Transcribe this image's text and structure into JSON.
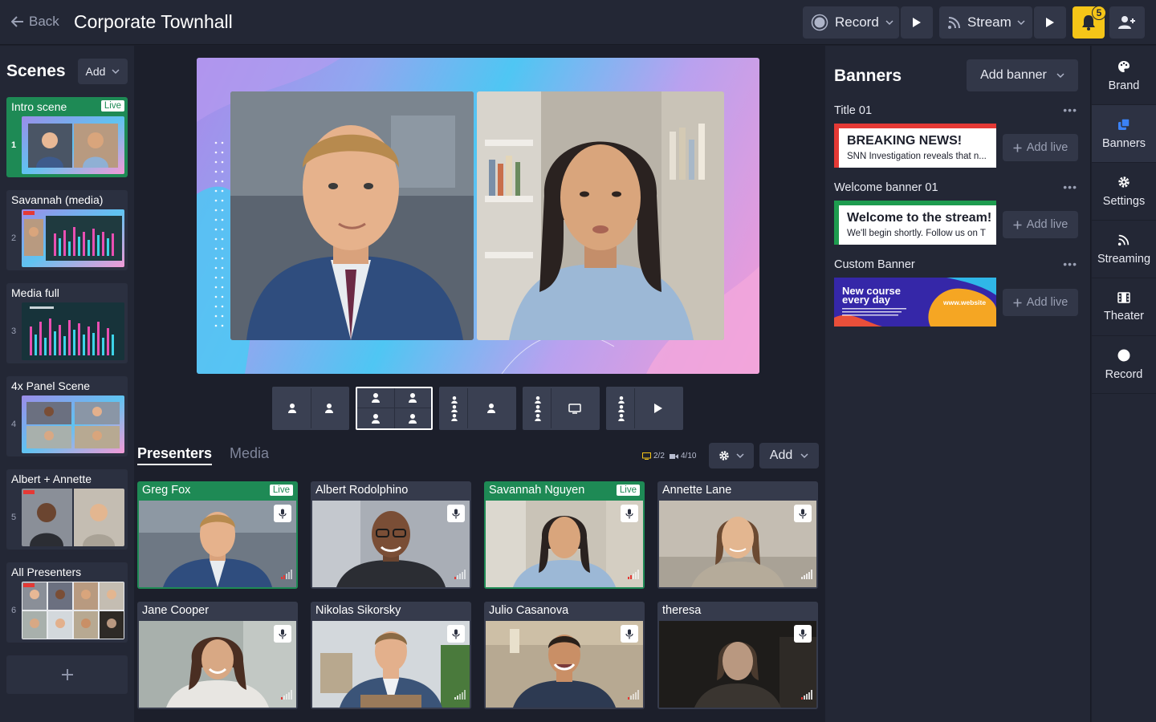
{
  "header": {
    "back_label": "Back",
    "title": "Corporate Townhall",
    "record_label": "Record",
    "stream_label": "Stream",
    "notifications_count": "5"
  },
  "scenes": {
    "title": "Scenes",
    "add_label": "Add",
    "items": [
      {
        "name": "Intro scene",
        "num": "1",
        "live": "Live"
      },
      {
        "name": "Savannah (media)",
        "num": "2"
      },
      {
        "name": "Media full",
        "num": "3"
      },
      {
        "name": "4x Panel Scene",
        "num": "4"
      },
      {
        "name": "Albert + Annette",
        "num": "5"
      },
      {
        "name": "All Presenters",
        "num": "6"
      }
    ]
  },
  "presenters": {
    "tab_presenters": "Presenters",
    "tab_media": "Media",
    "screens_count": "2/2",
    "cams_count": "4/10",
    "add_label": "Add",
    "live_label": "Live",
    "items": [
      {
        "name": "Greg Fox",
        "live": true
      },
      {
        "name": "Albert Rodolphino",
        "live": false
      },
      {
        "name": "Savannah Nguyen",
        "live": true
      },
      {
        "name": "Annette Lane",
        "live": false
      },
      {
        "name": "Jane Cooper",
        "live": false
      },
      {
        "name": "Nikolas Sikorsky",
        "live": false
      },
      {
        "name": "Julio Casanova",
        "live": false
      },
      {
        "name": "theresa",
        "live": false
      }
    ]
  },
  "banners": {
    "title": "Banners",
    "add_label": "Add banner",
    "add_live_label": "Add live",
    "groups": [
      {
        "label": "Title 01",
        "headline": "BREAKING NEWS!",
        "sub": "SNN Investigation reveals that n...",
        "color": "#e53935"
      },
      {
        "label": "Welcome banner 01",
        "headline": "Welcome to the stream!",
        "sub": "We'll begin shortly.  Follow us on T",
        "color": "#1e9c4f"
      },
      {
        "label": "Custom Banner",
        "headline": "New course every day",
        "website": "www.website"
      }
    ]
  },
  "rightnav": {
    "items": [
      {
        "label": "Brand"
      },
      {
        "label": "Banners"
      },
      {
        "label": "Settings"
      },
      {
        "label": "Streaming"
      },
      {
        "label": "Theater"
      },
      {
        "label": "Record"
      }
    ]
  },
  "colors": {
    "accent_green": "#1e8a55",
    "notification_yellow": "#f5c518",
    "active_nav_icon": "#3b82f6"
  }
}
